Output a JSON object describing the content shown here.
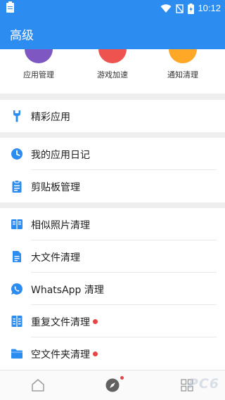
{
  "status_bar": {
    "time": "10:12",
    "icons": [
      "clipboard-icon",
      "wifi-icon",
      "no-signal-icon",
      "battery-charging-icon"
    ]
  },
  "app_bar": {
    "title": "高级"
  },
  "top_grid": [
    {
      "label": "应用管理",
      "icon": "app-manage-icon",
      "color": "#7e57c2"
    },
    {
      "label": "游戏加速",
      "icon": "game-boost-icon",
      "color": "#ef5350"
    },
    {
      "label": "通知清理",
      "icon": "notify-clean-icon",
      "color": "#ffa726"
    }
  ],
  "sections": [
    {
      "items": [
        {
          "label": "精彩应用",
          "icon": "wrench-icon",
          "dot": false
        }
      ]
    },
    {
      "items": [
        {
          "label": "我的应用日记",
          "icon": "clock-icon",
          "dot": false
        },
        {
          "label": "剪贴板管理",
          "icon": "clipboard-icon",
          "dot": false
        }
      ]
    },
    {
      "items": [
        {
          "label": "相似照片清理",
          "icon": "similar-photos-icon",
          "dot": false
        },
        {
          "label": "大文件清理",
          "icon": "document-icon",
          "dot": false
        },
        {
          "label": "WhatsApp 清理",
          "icon": "whatsapp-icon",
          "dot": false
        },
        {
          "label": "重复文件清理",
          "icon": "duplicate-file-icon",
          "dot": true
        },
        {
          "label": "空文件夹清理",
          "icon": "folder-icon",
          "dot": true
        }
      ]
    }
  ],
  "bottom_nav": [
    {
      "icon": "home-icon",
      "badge": false
    },
    {
      "icon": "compass-icon",
      "badge": true
    },
    {
      "icon": "apps-grid-icon",
      "badge": false
    }
  ],
  "watermark": "PC6",
  "colors": {
    "primary": "#2d8cf0",
    "accent_dot": "#e64545",
    "background": "#eeeeee"
  }
}
